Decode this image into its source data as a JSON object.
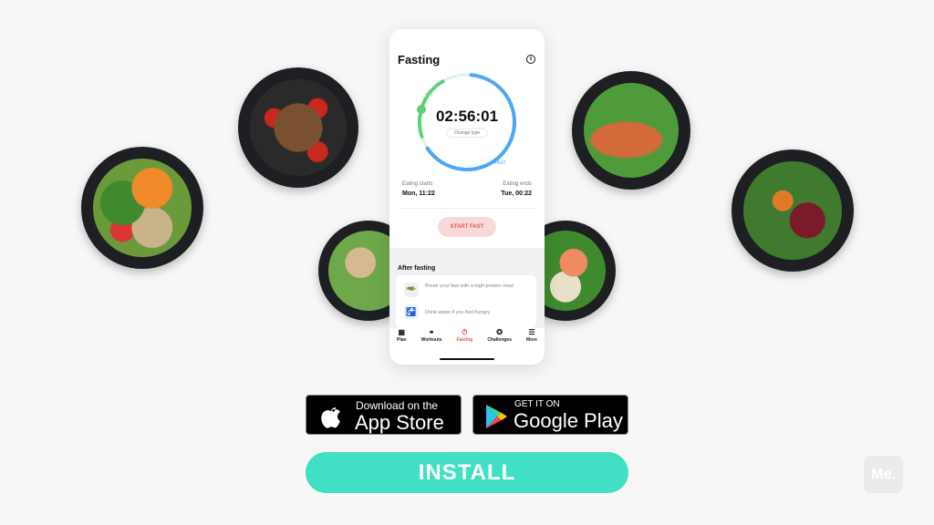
{
  "phone": {
    "title": "Fasting",
    "timer": "02:56:01",
    "change_type": "Change type",
    "ring_labels": {
      "eat": "EAT",
      "fast": "FAST"
    },
    "eating_starts": {
      "label": "Eating starts",
      "value": "Mon, 11:22"
    },
    "eating_ends": {
      "label": "Eating ends",
      "value": "Tue, 00:22"
    },
    "start_button": "START FAST",
    "after_title": "After fasting",
    "tips": [
      {
        "icon": "salad-icon",
        "text": "Break your fast with a high-protein meal"
      },
      {
        "icon": "water-tap-icon",
        "text": "Drink water if you feel hungry"
      }
    ],
    "nav": [
      {
        "label": "Plan",
        "icon": "calendar-icon"
      },
      {
        "label": "Workouts",
        "icon": "dumbbell-icon"
      },
      {
        "label": "Fasting",
        "icon": "timer-icon",
        "active": true
      },
      {
        "label": "Challenges",
        "icon": "medal-icon"
      },
      {
        "label": "More",
        "icon": "menu-icon"
      }
    ],
    "colors": {
      "fast": "#4aa8f7",
      "eat": "#5bd17a",
      "accent": "#e2584f"
    }
  },
  "app_store": {
    "small": "Download on the",
    "big": "App Store"
  },
  "google_play": {
    "small": "GET IT ON",
    "big": "Google Play"
  },
  "install": "INSTALL",
  "logo": "Me.",
  "colors": {
    "install": "#41dfc4"
  }
}
